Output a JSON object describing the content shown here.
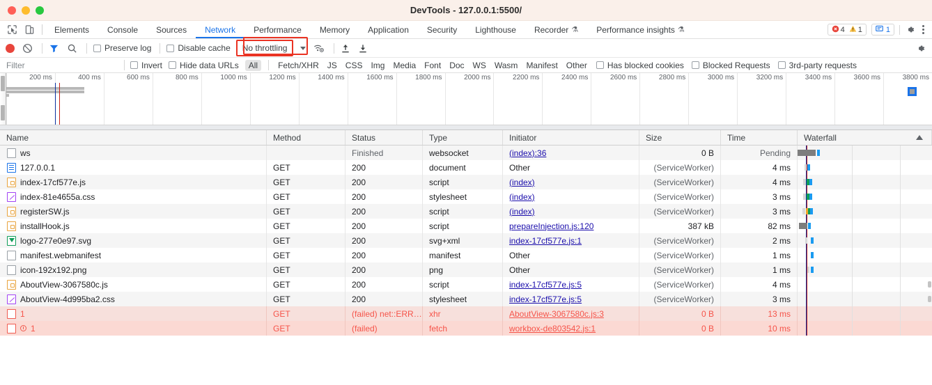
{
  "window": {
    "title": "DevTools - 127.0.0.1:5500/"
  },
  "tabbar": {
    "tabs": [
      {
        "label": "Elements",
        "active": false,
        "flask": false
      },
      {
        "label": "Console",
        "active": false,
        "flask": false
      },
      {
        "label": "Sources",
        "active": false,
        "flask": false
      },
      {
        "label": "Network",
        "active": true,
        "flask": false
      },
      {
        "label": "Performance",
        "active": false,
        "flask": false
      },
      {
        "label": "Memory",
        "active": false,
        "flask": false
      },
      {
        "label": "Application",
        "active": false,
        "flask": false
      },
      {
        "label": "Security",
        "active": false,
        "flask": false
      },
      {
        "label": "Lighthouse",
        "active": false,
        "flask": false
      },
      {
        "label": "Recorder",
        "active": false,
        "flask": true
      },
      {
        "label": "Performance insights",
        "active": false,
        "flask": true
      }
    ],
    "error_count": "4",
    "warning_count": "1",
    "message_count": "1",
    "flask_glyph": "⚗",
    "icons": {
      "inspect": "inspect-element-icon",
      "device": "device-toolbar-icon",
      "settings": "gear-icon",
      "more": "kebab-menu-icon"
    }
  },
  "toolbar": {
    "record_label": "record-button",
    "clear_label": "clear-button",
    "filter_label": "filter-button",
    "search_label": "search-button",
    "preserve_log": "Preserve log",
    "disable_cache": "Disable cache",
    "throttle_value": "No throttling",
    "wifi_label": "network-conditions-button",
    "import_label": "import-har-button",
    "export_label": "export-har-button",
    "settings_label": "network-settings-button"
  },
  "filterbar": {
    "filter_placeholder": "Filter",
    "invert": "Invert",
    "hide_data_urls": "Hide data URLs",
    "types": [
      {
        "label": "All",
        "selected": true
      },
      {
        "label": "Fetch/XHR",
        "selected": false
      },
      {
        "label": "JS",
        "selected": false
      },
      {
        "label": "CSS",
        "selected": false
      },
      {
        "label": "Img",
        "selected": false
      },
      {
        "label": "Media",
        "selected": false
      },
      {
        "label": "Font",
        "selected": false
      },
      {
        "label": "Doc",
        "selected": false
      },
      {
        "label": "WS",
        "selected": false
      },
      {
        "label": "Wasm",
        "selected": false
      },
      {
        "label": "Manifest",
        "selected": false
      },
      {
        "label": "Other",
        "selected": false
      }
    ],
    "has_blocked_cookies": "Has blocked cookies",
    "blocked_requests": "Blocked Requests",
    "third_party": "3rd-party requests"
  },
  "overview": {
    "ticks": [
      "200 ms",
      "400 ms",
      "600 ms",
      "800 ms",
      "1000 ms",
      "1200 ms",
      "1400 ms",
      "1600 ms",
      "1800 ms",
      "2000 ms",
      "2200 ms",
      "2400 ms",
      "2600 ms",
      "2800 ms",
      "3000 ms",
      "3200 ms",
      "3400 ms",
      "3600 ms",
      "3800 ms"
    ],
    "dom_content_loaded_ms": 200,
    "load_ms": 216,
    "marker_ms": 3700
  },
  "table": {
    "columns": [
      "Name",
      "Method",
      "Status",
      "Type",
      "Initiator",
      "Size",
      "Time",
      "Waterfall"
    ],
    "sort_column": "Waterfall",
    "sort_direction": "ascending",
    "rows": [
      {
        "icon": "plain",
        "name": "ws",
        "method": "",
        "status": "Finished",
        "type": "websocket",
        "initiator": "(index):36",
        "initiator_link": true,
        "size": "0 B",
        "time": "Pending",
        "error": false
      },
      {
        "icon": "doc",
        "name": "127.0.0.1",
        "method": "GET",
        "status": "200",
        "type": "document",
        "initiator": "Other",
        "initiator_link": false,
        "size": "(ServiceWorker)",
        "time": "4 ms",
        "error": false
      },
      {
        "icon": "js",
        "name": "index-17cf577e.js",
        "method": "GET",
        "status": "200",
        "type": "script",
        "initiator": "(index)",
        "initiator_link": true,
        "size": "(ServiceWorker)",
        "time": "4 ms",
        "error": false
      },
      {
        "icon": "css",
        "name": "index-81e4655a.css",
        "method": "GET",
        "status": "200",
        "type": "stylesheet",
        "initiator": "(index)",
        "initiator_link": true,
        "size": "(ServiceWorker)",
        "time": "3 ms",
        "error": false
      },
      {
        "icon": "js",
        "name": "registerSW.js",
        "method": "GET",
        "status": "200",
        "type": "script",
        "initiator": "(index)",
        "initiator_link": true,
        "size": "(ServiceWorker)",
        "time": "3 ms",
        "error": false
      },
      {
        "icon": "js",
        "name": "installHook.js",
        "method": "GET",
        "status": "200",
        "type": "script",
        "initiator": "prepareInjection.js:120",
        "initiator_link": true,
        "size": "387 kB",
        "time": "82 ms",
        "error": false
      },
      {
        "icon": "svg",
        "name": "logo-277e0e97.svg",
        "method": "GET",
        "status": "200",
        "type": "svg+xml",
        "initiator": "index-17cf577e.js:1",
        "initiator_link": true,
        "size": "(ServiceWorker)",
        "time": "2 ms",
        "error": false
      },
      {
        "icon": "plain",
        "name": "manifest.webmanifest",
        "method": "GET",
        "status": "200",
        "type": "manifest",
        "initiator": "Other",
        "initiator_link": false,
        "size": "(ServiceWorker)",
        "time": "1 ms",
        "error": false
      },
      {
        "icon": "plain",
        "name": "icon-192x192.png",
        "method": "GET",
        "status": "200",
        "type": "png",
        "initiator": "Other",
        "initiator_link": false,
        "size": "(ServiceWorker)",
        "time": "1 ms",
        "error": false
      },
      {
        "icon": "js",
        "name": "AboutView-3067580c.js",
        "method": "GET",
        "status": "200",
        "type": "script",
        "initiator": "index-17cf577e.js:5",
        "initiator_link": true,
        "size": "(ServiceWorker)",
        "time": "4 ms",
        "error": false
      },
      {
        "icon": "css",
        "name": "AboutView-4d995ba2.css",
        "method": "GET",
        "status": "200",
        "type": "stylesheet",
        "initiator": "index-17cf577e.js:5",
        "initiator_link": true,
        "size": "(ServiceWorker)",
        "time": "3 ms",
        "error": false
      },
      {
        "icon": "errbox",
        "name": "1",
        "method": "GET",
        "status": "(failed) net::ERR…",
        "type": "xhr",
        "initiator": "AboutView-3067580c.js:3",
        "initiator_link": true,
        "size": "0 B",
        "time": "13 ms",
        "error": true
      },
      {
        "icon": "errbox",
        "name": "1",
        "method": "GET",
        "status": "(failed)",
        "type": "fetch",
        "initiator": "workbox-de803542.js:1",
        "initiator_link": true,
        "size": "0 B",
        "time": "10 ms",
        "error": true,
        "error_badge": true
      }
    ]
  },
  "colors": {
    "accent": "#1a73e8",
    "error": "#f05a4f",
    "warning": "#f0a82a",
    "titlebar": "#faf0ea",
    "highlight_box": "#ea3323",
    "row_error_bg": "#fbd9d3"
  }
}
